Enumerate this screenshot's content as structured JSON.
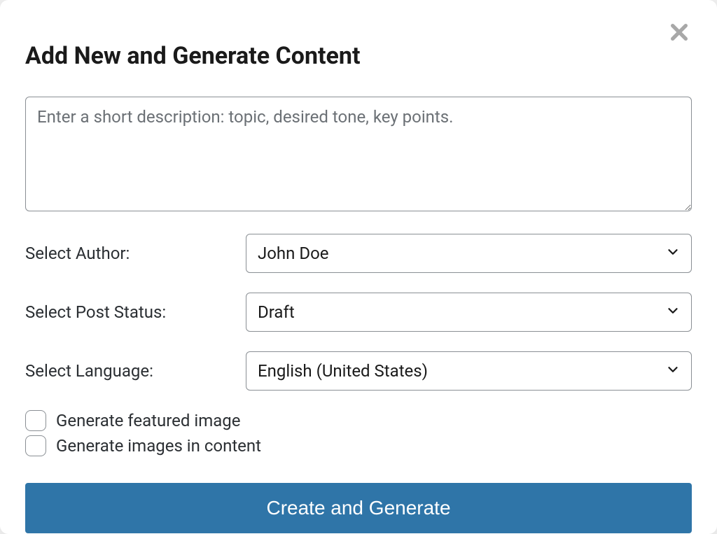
{
  "modal": {
    "title": "Add New and Generate Content",
    "description_placeholder": "Enter a short description: topic, desired tone, key points.",
    "fields": {
      "author": {
        "label": "Select Author:",
        "value": "John Doe"
      },
      "status": {
        "label": "Select Post Status:",
        "value": "Draft"
      },
      "language": {
        "label": "Select Language:",
        "value": "English (United States)"
      }
    },
    "checkboxes": {
      "featured_image": {
        "label": "Generate featured image",
        "checked": false
      },
      "images_in_content": {
        "label": "Generate images in content",
        "checked": false
      }
    },
    "submit_label": "Create and Generate"
  }
}
